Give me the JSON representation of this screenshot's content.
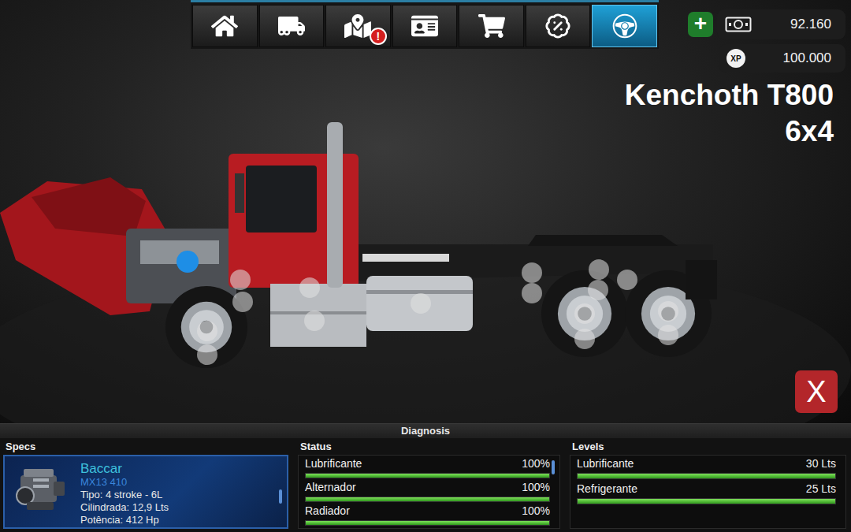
{
  "nav": {
    "alert_badge": "!",
    "items": [
      {
        "selected": false,
        "alert": false
      },
      {
        "selected": false,
        "alert": false
      },
      {
        "selected": false,
        "alert": true
      },
      {
        "selected": false,
        "alert": false
      },
      {
        "selected": false,
        "alert": false
      },
      {
        "selected": false,
        "alert": false
      },
      {
        "selected": true,
        "alert": false
      }
    ]
  },
  "wallet": {
    "add": "+",
    "money": "92.160",
    "xp_label": "XP",
    "xp": "100.000"
  },
  "vehicle": {
    "name": "Kenchoth T800",
    "drive": "6x4"
  },
  "hotspots": [
    {
      "selected": true
    },
    {
      "selected": false
    },
    {
      "selected": false
    },
    {
      "selected": false
    },
    {
      "selected": false
    },
    {
      "selected": false
    },
    {
      "selected": false
    },
    {
      "selected": false
    },
    {
      "selected": false
    },
    {
      "selected": false
    },
    {
      "selected": false
    },
    {
      "selected": false
    },
    {
      "selected": false
    },
    {
      "selected": false
    },
    {
      "selected": false
    },
    {
      "selected": false
    },
    {
      "selected": false
    }
  ],
  "close_button": {
    "label": "X"
  },
  "diagnosis": {
    "title": "Diagnosis",
    "specs": {
      "title": "Specs",
      "engine": {
        "brand": "Baccar",
        "model": "MX13 410",
        "lines": [
          "Tipo: 4 stroke - 6L",
          "Cilindrada: 12,9 Lts",
          "Potência: 412 Hp"
        ]
      }
    },
    "status": {
      "title": "Status",
      "items": [
        {
          "name": "Lubrificante",
          "reading": "100%",
          "level": 1
        },
        {
          "name": "Alternador",
          "reading": "100%",
          "level": 1
        },
        {
          "name": "Radiador",
          "reading": "100%",
          "level": 1
        }
      ]
    },
    "levels": {
      "title": "Levels",
      "items": [
        {
          "name": "Lubrificante",
          "reading": "30 Lts",
          "level": 1
        },
        {
          "name": "Refrigerante",
          "reading": "25 Lts",
          "level": 1
        }
      ]
    }
  }
}
